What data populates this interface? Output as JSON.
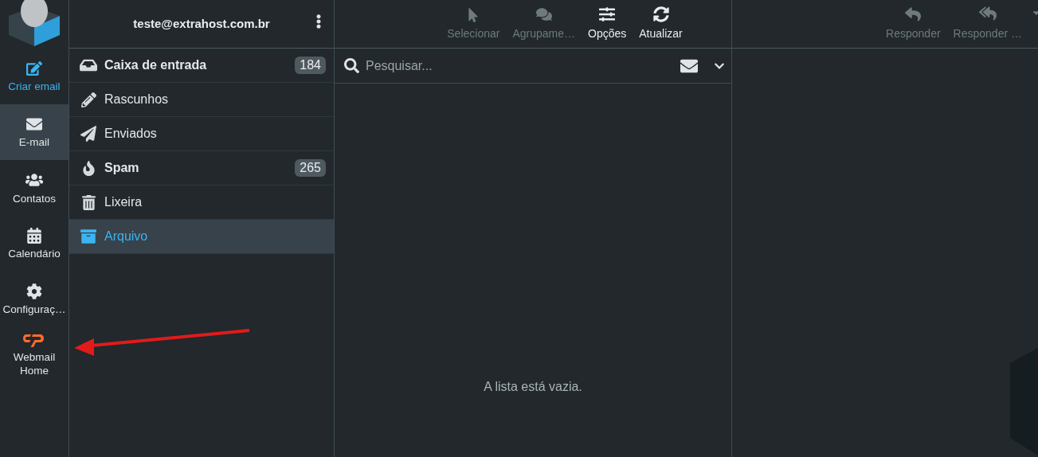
{
  "account": {
    "email": "teste@extrahost.com.br"
  },
  "nav": [
    {
      "label": "Criar email",
      "kind": "action",
      "selected": false
    },
    {
      "label": "E-mail",
      "kind": "section",
      "selected": true
    },
    {
      "label": "Contatos",
      "kind": "section",
      "selected": false
    },
    {
      "label": "Calendário",
      "kind": "section",
      "selected": false
    },
    {
      "label": "Configuraç…",
      "kind": "section",
      "selected": false
    },
    {
      "label": "Webmail Home",
      "kind": "section",
      "selected": false
    }
  ],
  "folders": [
    {
      "name": "Caixa de entrada",
      "count": "184",
      "unread": true,
      "selected": false
    },
    {
      "name": "Rascunhos",
      "unread": false,
      "selected": false
    },
    {
      "name": "Enviados",
      "unread": false,
      "selected": false
    },
    {
      "name": "Spam",
      "count": "265",
      "unread": true,
      "selected": false
    },
    {
      "name": "Lixeira",
      "unread": false,
      "selected": false
    },
    {
      "name": "Arquivo",
      "unread": false,
      "selected": true
    }
  ],
  "list_toolbar": [
    {
      "label": "Selecionar",
      "disabled": true
    },
    {
      "label": "Agrupame…",
      "disabled": true
    },
    {
      "label": "Opções",
      "disabled": false
    },
    {
      "label": "Atualizar",
      "disabled": false
    }
  ],
  "search": {
    "placeholder": "Pesquisar..."
  },
  "message_list": {
    "empty_text": "A lista está vazia."
  },
  "message_toolbar": [
    {
      "label": "Responder",
      "disabled": true
    },
    {
      "label": "Responder …",
      "disabled": true
    }
  ]
}
